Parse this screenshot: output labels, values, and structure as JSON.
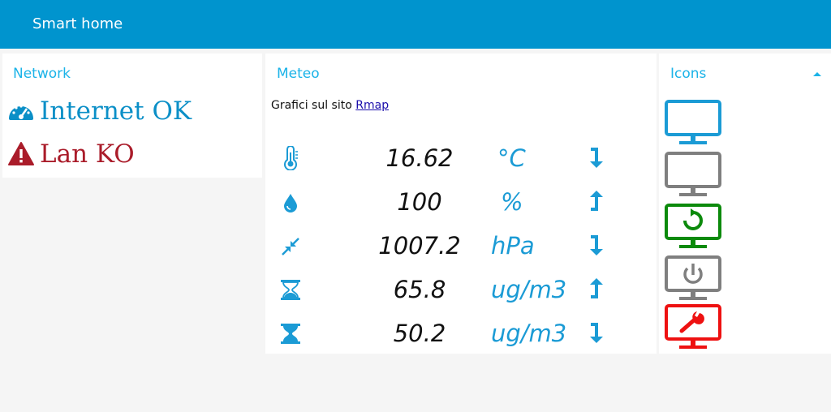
{
  "app": {
    "title": "Smart home"
  },
  "network": {
    "title": "Network",
    "items": [
      {
        "label": "Internet OK",
        "icon": "speedometer-icon",
        "color": "#0b8fc7"
      },
      {
        "label": "Lan KO",
        "icon": "warning-icon",
        "color": "#aa1c2a"
      }
    ]
  },
  "meteo": {
    "title": "Meteo",
    "note_prefix": "Grafici sul sito",
    "note_link": "Rmap",
    "rows": [
      {
        "icon": "thermometer-icon",
        "value": "16.62",
        "unit": "°C",
        "trend": "down"
      },
      {
        "icon": "water-drop-icon",
        "value": "100",
        "unit": "%",
        "trend": "up"
      },
      {
        "icon": "pressure-compress-icon",
        "value": "1007.2",
        "unit": "hPa",
        "trend": "down"
      },
      {
        "icon": "hourglass-half-icon",
        "value": "65.8",
        "unit": "ug/m3",
        "trend": "up"
      },
      {
        "icon": "hourglass-full-icon",
        "value": "50.2",
        "unit": "ug/m3",
        "trend": "down"
      }
    ]
  },
  "icons": {
    "title": "Icons",
    "monitors": [
      {
        "name": "monitor-blue-icon",
        "color": "#1b9bd5"
      },
      {
        "name": "monitor-grey-icon",
        "color": "#7f7f7f"
      },
      {
        "name": "monitor-green-refresh-icon",
        "color": "#0c8a0c"
      },
      {
        "name": "monitor-grey-power-icon",
        "color": "#7f7f7f"
      },
      {
        "name": "monitor-red-wrench-icon",
        "color": "#ee1111"
      }
    ]
  },
  "colors": {
    "brand": "#0094ce",
    "accent": "#1b9bd5",
    "panel_title": "#1bb3e8"
  }
}
